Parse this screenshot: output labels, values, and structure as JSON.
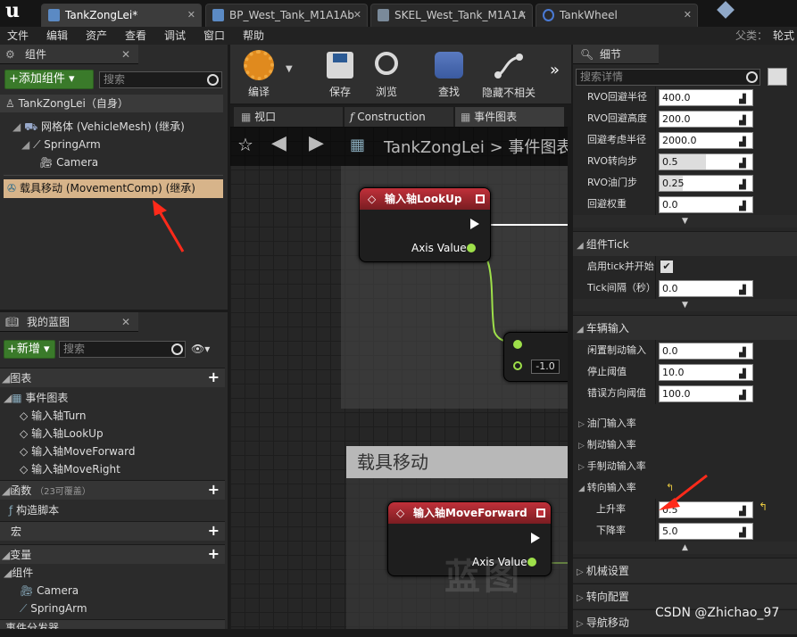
{
  "tabs": [
    {
      "label": "TankZongLei*",
      "color": "#5b8ac4"
    },
    {
      "label": "BP_West_Tank_M1A1Ab",
      "color": "#5b8ac4"
    },
    {
      "label": "SKEL_West_Tank_M1A1A",
      "color": "#7a8a9a"
    },
    {
      "label": "TankWheel",
      "color": "#4a7ad4"
    }
  ],
  "menu": [
    "文件",
    "编辑",
    "资产",
    "查看",
    "调试",
    "窗口",
    "帮助"
  ],
  "parent_label": "父类：",
  "parent_value": "轮式",
  "components": {
    "title": "组件",
    "add_label": "+添加组件 ▾",
    "search_placeholder": "搜索",
    "root": "TankZongLei（自身）",
    "items": [
      "网格体 (VehicleMesh) (继承)",
      "SpringArm",
      "Camera",
      "载具移动 (MovementComp) (继承)"
    ]
  },
  "blueprint": {
    "title": "我的蓝图",
    "new_label": "+新增 ▾",
    "search_placeholder": "搜索",
    "graphs_label": "图表",
    "event_graph": "事件图表",
    "events": [
      "输入轴Turn",
      "输入轴LookUp",
      "输入轴MoveForward",
      "输入轴MoveRight"
    ],
    "functions_label": "函数",
    "functions_note": "（23可覆盖）",
    "construct_script": "构造脚本",
    "macros_label": "宏",
    "variables_label": "变量",
    "components_label": "组件",
    "var_items": [
      "Camera",
      "SpringArm"
    ],
    "dispatchers_label": "事件分发器"
  },
  "toolbar": {
    "compile": "编译",
    "save": "保存",
    "browse": "浏览",
    "find": "查找",
    "hide": "隐藏不相关"
  },
  "graph_tabs": [
    "视口",
    "Construction",
    "事件图表"
  ],
  "breadcrumb": {
    "root": "TankZongLei",
    "current": "事件图表"
  },
  "nodes": {
    "lookup_title": "输入轴LookUp",
    "axis_value": "Axis Value",
    "neg_value": "-1.0",
    "comment_title": "载具移动",
    "moveforward_title": "输入轴MoveForward",
    "watermark": "蓝图"
  },
  "details": {
    "title": "细节",
    "search_placeholder": "搜索详情",
    "rvo_rows": [
      {
        "label": "RVO回避半径",
        "value": "400.0"
      },
      {
        "label": "RVO回避高度",
        "value": "200.0"
      },
      {
        "label": "回避考虑半径",
        "value": "2000.0"
      },
      {
        "label": "RVO转向步",
        "value": "0.5"
      },
      {
        "label": "RVO油门步",
        "value": "0.25"
      },
      {
        "label": "回避权重",
        "value": "0.0"
      }
    ],
    "tick_section": "组件Tick",
    "tick_rows": [
      {
        "label": "启用tick并开始",
        "value": "✔"
      },
      {
        "label": "Tick间隔（秒）",
        "value": "0.0"
      }
    ],
    "vehicle_section": "车辆输入",
    "vehicle_rows": [
      {
        "label": "闲置制动输入",
        "value": "0.0"
      },
      {
        "label": "停止阈值",
        "value": "10.0"
      },
      {
        "label": "错误方向阈值",
        "value": "100.0"
      }
    ],
    "collapsed": [
      "油门输入率",
      "制动输入率",
      "手制动输入率",
      "转向输入率"
    ],
    "steer_rows": [
      {
        "label": "上升率",
        "value": "0.5"
      },
      {
        "label": "下降率",
        "value": "5.0"
      }
    ],
    "bottom_sections": [
      "机械设置",
      "转向配置",
      "导航移动"
    ]
  },
  "watermark": "CSDN @Zhichao_97",
  "accent": "#ff2a1a"
}
